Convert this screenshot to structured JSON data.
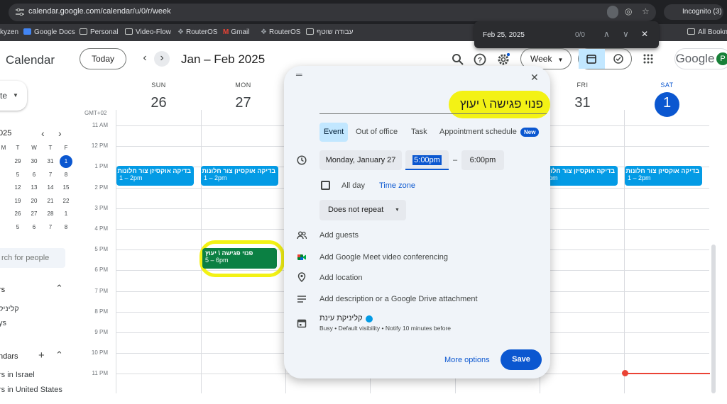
{
  "browser": {
    "url": "calendar.google.com/calendar/u/0/r/week",
    "incognito_label": "Incognito (3)",
    "bookmarks": [
      "kyzen",
      "Google Docs",
      "Personal",
      "Video-Flow",
      "RouterOS",
      "Gmail",
      "RouterOS",
      "עבודה שוטף"
    ],
    "all_bookmarks": "All Bookm",
    "find": {
      "query": "Feb 25, 2025",
      "count": "0/0"
    }
  },
  "header": {
    "app_title": "Calendar",
    "today_label": "Today",
    "range_label": "Jan – Feb 2025",
    "view_label": "Week",
    "logo_text": "Google",
    "avatar_letter": "P"
  },
  "sidebar": {
    "create_label": "te",
    "mini_month": "025",
    "mini_weekdays": [
      "M",
      "T",
      "W",
      "T",
      "F",
      "S"
    ],
    "mini_weeks": [
      [
        "29",
        "30",
        "31",
        "1"
      ],
      [
        "5",
        "6",
        "7",
        "8"
      ],
      [
        "12",
        "13",
        "14",
        "15"
      ],
      [
        "19",
        "20",
        "21",
        "22"
      ],
      [
        "26",
        "27",
        "28",
        "1"
      ],
      [
        "5",
        "6",
        "7",
        "8"
      ]
    ],
    "mini_first_col": [
      "M",
      "",
      "",
      "",
      "",
      "",
      ""
    ],
    "search_placeholder": "rch for people",
    "my_calendars_heading": "rs",
    "my_calendar_items": [
      "קליניק",
      "ys"
    ],
    "other_calendars_heading": "ndars",
    "other_calendar_items": [
      "rs in Israel",
      "rs in United States"
    ]
  },
  "grid": {
    "gmt": "GMT+02",
    "days": [
      {
        "name": "SUN",
        "num": "26"
      },
      {
        "name": "MON",
        "num": "27"
      },
      {
        "name": "FRI",
        "num": "31"
      },
      {
        "name": "SAT",
        "num": "1",
        "today": true
      }
    ],
    "time_labels": [
      "11 AM",
      "12 PM",
      "1 PM",
      "2 PM",
      "3 PM",
      "4 PM",
      "5 PM",
      "6 PM",
      "7 PM",
      "8 PM",
      "9 PM",
      "10 PM",
      "11 PM"
    ],
    "events": [
      {
        "title": "בדיקה אוקסיזן צור חלונות",
        "time": "1 – 2pm"
      },
      {
        "title": "בדיקה אוקסיזן צור חלונות",
        "time": "1 – 2pm"
      },
      {
        "title": "בדיקה אוקסיזן צור חלונות",
        "time": "2pm"
      },
      {
        "title": "בדיקה אוקסיזן צור חלונות",
        "time": "1 – 2pm"
      },
      {
        "title": "פנוי פגישה \\ יעוץ",
        "time": "5 – 6pm"
      }
    ]
  },
  "modal": {
    "title_value": "פנוי פגישה \\ יעוץ",
    "tabs": [
      "Event",
      "Out of office",
      "Task",
      "Appointment schedule"
    ],
    "new_badge": "New",
    "date": "Monday, January 27",
    "start_time": "5:00pm",
    "dash": "–",
    "end_time": "6:00pm",
    "all_day_label": "All day",
    "time_zone_label": "Time zone",
    "repeat_label": "Does not repeat",
    "add_guests": "Add guests",
    "add_meet": "Add Google Meet video conferencing",
    "add_location": "Add location",
    "add_description": "Add description or a Google Drive attachment",
    "calendar_name": "קליניקת עינת",
    "calendar_details": "Busy • Default visibility • Notify 10 minutes before",
    "more_options": "More options",
    "save": "Save"
  },
  "colors": {
    "event_blue": "#039be5",
    "selected_event": "#0b8043",
    "highlight_yellow": "#f3f215",
    "primary": "#0b57d0",
    "now_line": "#ea4335"
  }
}
